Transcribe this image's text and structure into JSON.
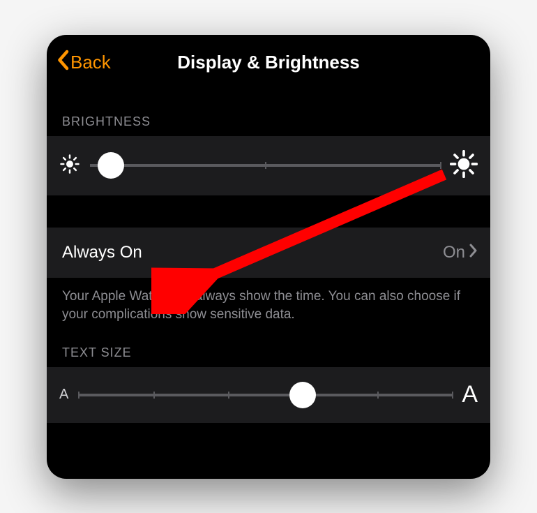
{
  "nav": {
    "back_label": "Back",
    "title": "Display & Brightness"
  },
  "brightness": {
    "section_label": "BRIGHTNESS",
    "value_percent": 6
  },
  "always_on": {
    "label": "Always On",
    "value": "On",
    "footer": "Your Apple Watch can always show the time. You can also choose if your complications show sensitive data."
  },
  "text_size": {
    "section_label": "TEXT SIZE",
    "small_glyph": "A",
    "large_glyph": "A",
    "value_percent": 60
  }
}
